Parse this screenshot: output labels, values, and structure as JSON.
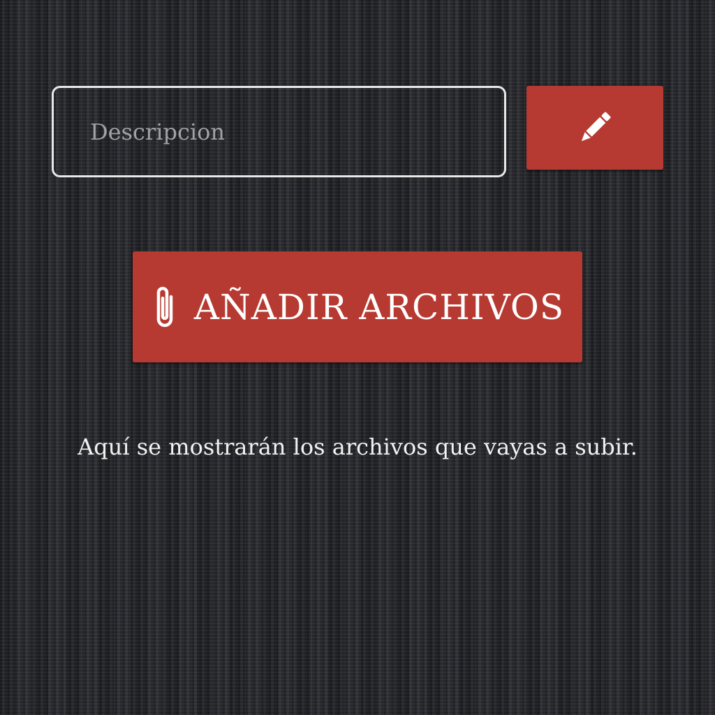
{
  "form": {
    "description_placeholder": "Descripcion",
    "description_value": "",
    "edit_icon": "pencil-icon"
  },
  "upload": {
    "button_label": "AÑADIR ARCHIVOS",
    "button_icon": "paperclip-icon"
  },
  "files": {
    "empty_message": "Aquí se mostrarán los archivos que vayas a subir."
  },
  "colors": {
    "accent": "#b63a31",
    "background": "#2a2b30",
    "text": "#f2f2f2",
    "placeholder": "#a2a2a5"
  }
}
